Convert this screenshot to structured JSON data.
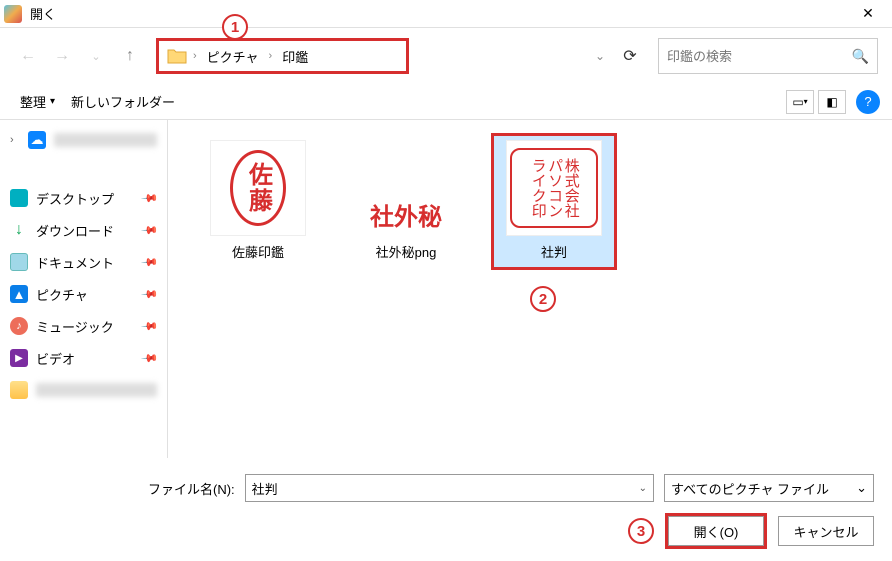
{
  "window": {
    "title": "開く"
  },
  "breadcrumb": {
    "parts": [
      "ピクチャ",
      "印鑑"
    ]
  },
  "search": {
    "placeholder": "印鑑の検索"
  },
  "toolbar": {
    "organize": "整理",
    "new_folder": "新しいフォルダー"
  },
  "sidebar": {
    "items": [
      {
        "icon": "cloud",
        "label": ""
      },
      {
        "icon": "desktop",
        "label": "デスクトップ",
        "pinned": true
      },
      {
        "icon": "download",
        "label": "ダウンロード",
        "pinned": true
      },
      {
        "icon": "doc",
        "label": "ドキュメント",
        "pinned": true
      },
      {
        "icon": "pics",
        "label": "ピクチャ",
        "pinned": true
      },
      {
        "icon": "music",
        "label": "ミュージック",
        "pinned": true
      },
      {
        "icon": "video",
        "label": "ビデオ",
        "pinned": true
      },
      {
        "icon": "folder-i",
        "label": ""
      }
    ]
  },
  "files": [
    {
      "name": "佐藤印鑑",
      "badge_text": "佐藤"
    },
    {
      "name": "社外秘png",
      "badge_text": "社外秘"
    },
    {
      "name": "社判",
      "selected": true,
      "lines": [
        "株式会社",
        "パソコン",
        "ライク印"
      ]
    }
  ],
  "footer": {
    "filename_label": "ファイル名(N):",
    "filename_value": "社判",
    "filter_value": "すべてのピクチャ ファイル",
    "open_btn": "開く(O)",
    "cancel_btn": "キャンセル"
  },
  "annotations": {
    "a1": "1",
    "a2": "2",
    "a3": "3"
  }
}
